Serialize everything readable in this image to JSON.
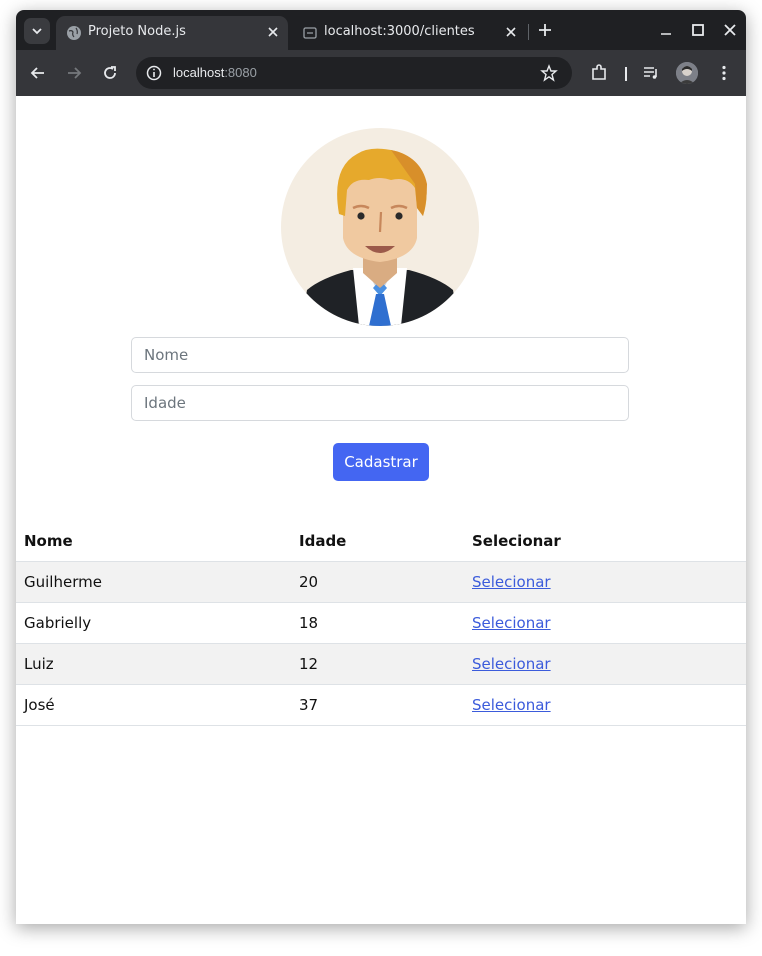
{
  "browser": {
    "tabs": [
      {
        "title": "Projeto Node.js",
        "favicon": "globe-icon",
        "active": true
      },
      {
        "title": "localhost:3000/clientes",
        "favicon": "page-icon",
        "active": false
      }
    ],
    "url_host": "localhost",
    "url_port": ":8080"
  },
  "form": {
    "avatar": "businessman-avatar",
    "nome_placeholder": "Nome",
    "idade_placeholder": "Idade",
    "submit_label": "Cadastrar"
  },
  "table": {
    "headers": [
      "Nome",
      "Idade",
      "Selecionar"
    ],
    "rows": [
      {
        "nome": "Guilherme",
        "idade": "20",
        "acao": "Selecionar"
      },
      {
        "nome": "Gabrielly",
        "idade": "18",
        "acao": "Selecionar"
      },
      {
        "nome": "Luiz",
        "idade": "12",
        "acao": "Selecionar"
      },
      {
        "nome": "José",
        "idade": "37",
        "acao": "Selecionar"
      }
    ]
  },
  "colors": {
    "primary_button": "#4466f2",
    "link": "#3b5bdb",
    "stripe": "#f2f2f2"
  }
}
